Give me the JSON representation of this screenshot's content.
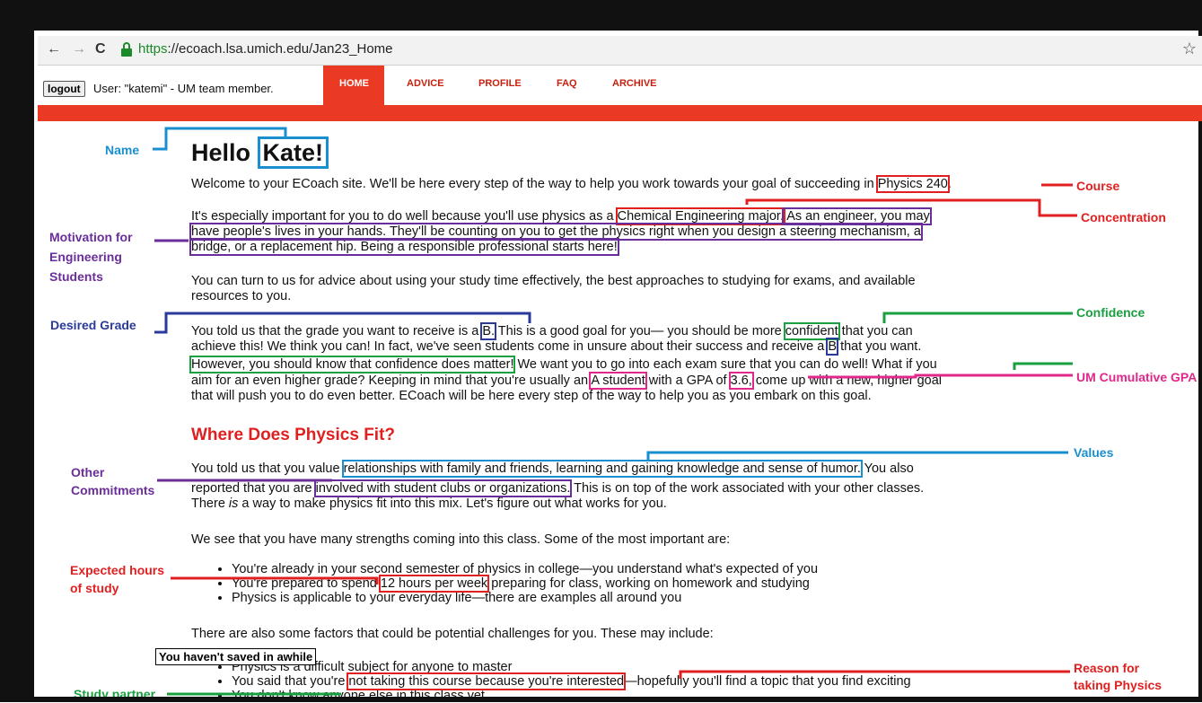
{
  "browser": {
    "back": "←",
    "forward": "→",
    "reload": "C",
    "url_scheme": "https",
    "url_rest": "://ecoach.lsa.umich.edu/Jan23_Home",
    "star": "☆"
  },
  "userbar": {
    "logout": "logout",
    "user": "User: \"katemi\" - UM team member."
  },
  "tabs": [
    "HOME",
    "ADVICE",
    "PROFILE",
    "FAQ",
    "ARCHIVE"
  ],
  "greeting": {
    "hello": "Hello",
    "name": "Kate!"
  },
  "p1": {
    "a": "Welcome to your ECoach site. We'll be here every step of the way to help you work towards your goal of succeeding in ",
    "course": "Physics 240",
    "b": "."
  },
  "p2": {
    "a": "It's especially important for you to do well because you'll use physics as a ",
    "concentration": "Chemical Engineering major.",
    "motivation1": " As an engineer, you may",
    "motivation2": "have people's lives in your hands. They'll be counting on you to get the physics right when you design a steering mechanism, a",
    "motivation3": "bridge, or a replacement hip. Being a responsible professional starts here!"
  },
  "p3": {
    "line1": "You can turn to us for advice about using your study time effectively, the best approaches to studying for exams, and available",
    "line2": "resources to you."
  },
  "p4": {
    "a": "You told us that the grade you want to receive is a ",
    "grade": "B.",
    "b": " This is a good goal for you— you should be more ",
    "confident": "confident",
    "c": " that you can",
    "d": "achieve this! We think you can! In fact, we've seen students come in unsure about their success and receive a ",
    "grade2": "B",
    "e": " that you want.",
    "confidence_sentence": "However, you should know that confidence does matter!",
    "f": " We want you to go into each exam sure that you can do well! What if you",
    "g": "aim for an even higher grade? Keeping in mind that you're usually an ",
    "astudent": "A student",
    "h": " with a GPA of ",
    "gpa": "3.6,",
    "i": " come up with a new, higher goal",
    "j": "that will push you to do even better. ECoach will be here every step of the way to help you as you embark on this goal."
  },
  "section_title": "Where Does Physics Fit?",
  "p5": {
    "a": "You told us that you value ",
    "values": "relationships with family and friends, learning and gaining knowledge and sense of humor.",
    "b": " You also",
    "c": "reported that you are ",
    "commitments": "involved with student clubs or organizations.",
    "d": " This is on top of the work associated with your other classes.",
    "e1": "There ",
    "e_is": "is",
    "e2": " a way to make physics fit into this mix. Let's figure out what works for you."
  },
  "p6": "We see that you have many strengths coming into this class. Some of the most important are:",
  "strengths": {
    "s1": "You're already in your second semester of physics in college—you understand what's expected of you",
    "s2a": "You're prepared to spend ",
    "hours": "12 hours per week",
    "s2b": " preparing for class, working on homework and studying",
    "s3": "Physics is applicable to your everyday life—there are examples all around you"
  },
  "p7": "There are also some factors that could be potential challenges for you. These may include:",
  "challenges": {
    "c1": "Physics is a difficult subject for anyone to master",
    "c2a": "You said that you're ",
    "reason": "not taking this course because you're interested",
    "c2b": "—hopefully you'll find a topic that you find exciting",
    "c3": "You don't know anyone else in this class yet"
  },
  "tooltip": "You haven't saved in awhile",
  "annotations": {
    "name": "Name",
    "course": "Course",
    "concentration": "Concentration",
    "motivation": [
      "Motivation for",
      "Engineering",
      "Students"
    ],
    "desired_grade": "Desired Grade",
    "confidence": "Confidence",
    "gpa": "UM Cumulative GPA",
    "values": "Values",
    "other_commitments": [
      "Other",
      "Commitments"
    ],
    "expected_hours": [
      "Expected hours",
      "of study"
    ],
    "reason": [
      "Reason for",
      "taking Physics"
    ],
    "study_partner": "Study partner"
  },
  "colors": {
    "red": "#e02020",
    "purple": "#6a2e9a",
    "blue": "#1a8fd0",
    "green": "#1aa040",
    "navy": "#2a3a9a",
    "pink": "#e0288a",
    "tab_bar": "#ea3a23"
  }
}
